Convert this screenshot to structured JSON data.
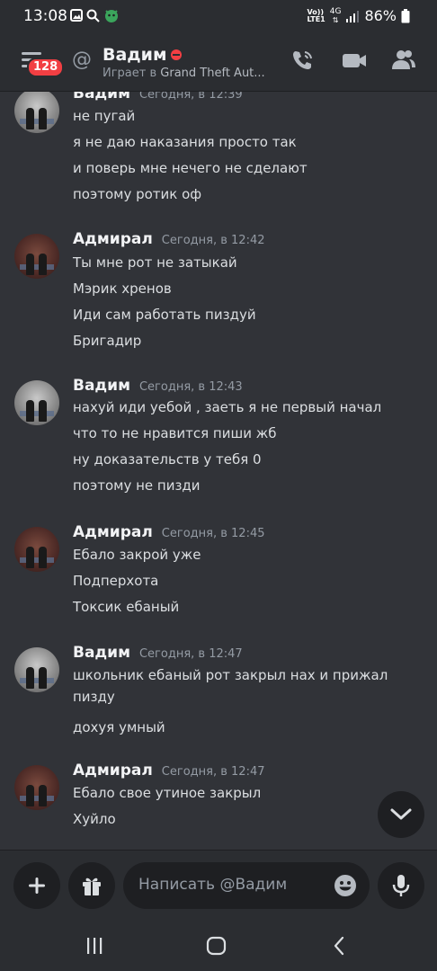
{
  "status_bar": {
    "time": "13:08",
    "network_top": "Vo))",
    "network_bottom": "LTE1",
    "network_gen": "4G",
    "battery": "86%"
  },
  "header": {
    "menu_badge": "128",
    "user_name": "Вадим",
    "status_prefix": "Играет в ",
    "status_game": "Grand Theft Aut..."
  },
  "messages": [
    {
      "author": "Вадим",
      "time": "Сегодня, в 12:39",
      "avatar": "vadim",
      "lines": [
        "не пугай",
        "я не даю наказания просто так",
        "и поверь мне нечего не сделают",
        "поэтому ротик оф"
      ]
    },
    {
      "author": "Адмирал",
      "time": "Сегодня, в 12:42",
      "avatar": "admiral",
      "lines": [
        "Ты мне рот не затыкай",
        "Мэрик хренов",
        "Иди сам работать пиздуй",
        "Бригадир"
      ]
    },
    {
      "author": "Вадим",
      "time": "Сегодня, в 12:43",
      "avatar": "vadim",
      "lines": [
        "нахуй иди  уебой , заеть  я не первый начал",
        "что то не нравится пиши жб",
        "ну доказательств у тебя 0",
        "поэтому не пизди"
      ]
    },
    {
      "author": "Адмирал",
      "time": "Сегодня, в 12:45",
      "avatar": "admiral",
      "lines": [
        "Ебало закрой уже",
        "Подперхота",
        "Токсик ебаный"
      ]
    },
    {
      "author": "Вадим",
      "time": "Сегодня, в 12:47",
      "avatar": "vadim",
      "lines": [
        "школьник ебаный рот закрыл нах  и прижал пизду",
        "дохуя умный"
      ]
    },
    {
      "author": "Адмирал",
      "time": "Сегодня, в 12:47",
      "avatar": "admiral",
      "lines": [
        "Ебало свое утиное закрыл",
        "Хуйло"
      ]
    }
  ],
  "composer": {
    "placeholder": "Написать @Вадим"
  },
  "icons": {
    "menu": "hamburger-icon",
    "at": "at-sign-icon",
    "call": "phone-call-icon",
    "video": "video-camera-icon",
    "members": "members-icon",
    "scroll_down": "chevron-down-icon",
    "add": "plus-icon",
    "gift": "gift-icon",
    "emoji": "smile-emoji-icon",
    "mic": "microphone-icon",
    "nav_recents": "recents-icon",
    "nav_home": "home-icon",
    "nav_back": "back-icon"
  },
  "colors": {
    "background": "#313338",
    "header": "#2b2d31",
    "input": "#1e1f22",
    "badge": "#f23f43",
    "text": "#dbdee1",
    "muted": "#949ba4"
  }
}
